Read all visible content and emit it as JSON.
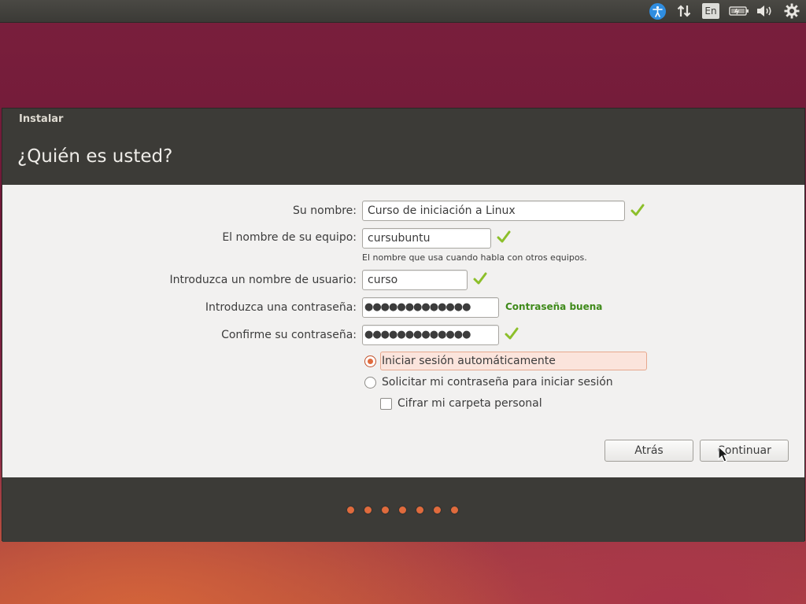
{
  "top_panel": {
    "indicators": [
      {
        "name": "accessibility-icon"
      },
      {
        "name": "network-icon"
      },
      {
        "name": "keyboard-language-indicator",
        "label": "En"
      },
      {
        "name": "battery-icon"
      },
      {
        "name": "volume-icon"
      },
      {
        "name": "system-gear-icon"
      }
    ]
  },
  "window": {
    "title": "Instalar",
    "heading": "¿Quién es usted?"
  },
  "form": {
    "name_label": "Su nombre:",
    "name_value": "Curso de iniciación a Linux",
    "computer_label": "El nombre de su equipo:",
    "computer_value": "cursubuntu",
    "computer_hint": "El nombre que usa cuando habla con otros equipos.",
    "username_label": "Introduzca un nombre de usuario:",
    "username_value": "curso",
    "password_label": "Introduzca una contraseña:",
    "password_value": "●●●●●●●●●●●●●",
    "password_strength": "Contraseña buena",
    "confirm_label": "Confirme su contraseña:",
    "confirm_value": "●●●●●●●●●●●●●",
    "option_autologin": "Iniciar sesión automáticamente",
    "option_require_password": "Solicitar mi contraseña para iniciar sesión",
    "option_encrypt_home": "Cifrar mi carpeta personal",
    "selected_option": "option_autologin",
    "encrypt_home_checked": false
  },
  "buttons": {
    "back": "Atrás",
    "continue": "Continuar"
  },
  "progress": {
    "total_steps": 7
  },
  "colors": {
    "accent": "#e06b3d",
    "header_bg": "#3c3b37",
    "check_green": "#8cbf2a",
    "strength_green": "#3f8a1a"
  }
}
